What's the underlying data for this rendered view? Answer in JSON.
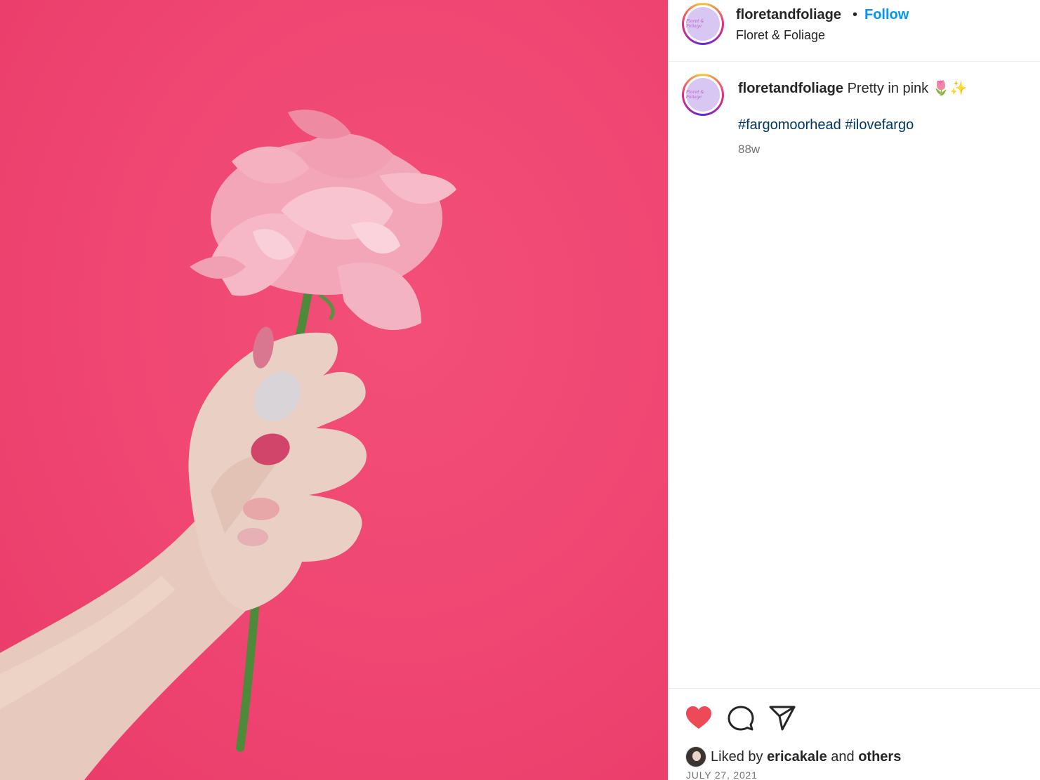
{
  "header": {
    "username": "floretandfoliage",
    "separator": "•",
    "follow_label": "Follow",
    "subtitle": "Floret & Foliage",
    "avatar_logo_text": "Floret & Foliage"
  },
  "caption": {
    "username": "floretandfoliage",
    "text": "Pretty in pink",
    "emoji": "🌷✨",
    "hashtags": [
      "#fargomoorhead",
      "#ilovefargo"
    ],
    "time": "88w"
  },
  "actions": {
    "like_icon": "heart-filled-icon",
    "comment_icon": "comment-icon",
    "share_icon": "share-icon",
    "like_color": "#ed4956"
  },
  "likes": {
    "prefix": "Liked by",
    "user": "ericakale",
    "middle": "and",
    "others": "others"
  },
  "date": "JULY 27, 2021",
  "colors": {
    "accent": "#0095f6",
    "hashtag": "#00376b",
    "photo_background": "#ef4572"
  }
}
